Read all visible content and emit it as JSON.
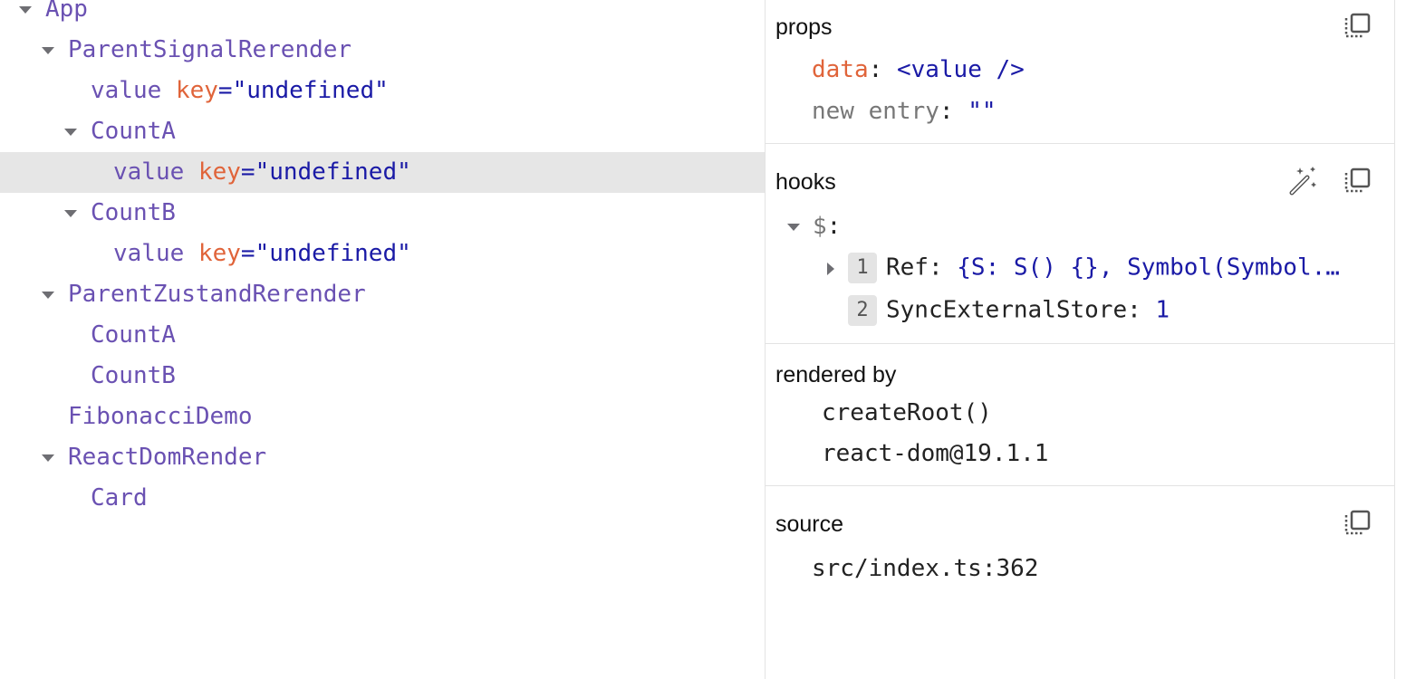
{
  "tree": [
    {
      "name": "App",
      "level": 0,
      "expanded": true
    },
    {
      "name": "ParentSignalRerender",
      "level": 1,
      "expanded": true
    },
    {
      "name": "value",
      "level": 2,
      "key_label": "key",
      "key_value": "\"undefined\""
    },
    {
      "name": "CountA",
      "level": 2,
      "expanded": true
    },
    {
      "name": "value",
      "level": 3,
      "key_label": "key",
      "key_value": "\"undefined\"",
      "selected": true
    },
    {
      "name": "CountB",
      "level": 2,
      "expanded": true
    },
    {
      "name": "value",
      "level": 3,
      "key_label": "key",
      "key_value": "\"undefined\""
    },
    {
      "name": "ParentZustandRerender",
      "level": 1,
      "expanded": true
    },
    {
      "name": "CountA",
      "level": 2
    },
    {
      "name": "CountB",
      "level": 2
    },
    {
      "name": "FibonacciDemo",
      "level": 1
    },
    {
      "name": "ReactDomRender",
      "level": 1,
      "expanded": true
    },
    {
      "name": "Card",
      "level": 2
    }
  ],
  "props": {
    "title": "props",
    "data_key": "data",
    "data_value": "<value />",
    "new_entry_key": "new entry",
    "new_entry_value": "\"\""
  },
  "hooks": {
    "title": "hooks",
    "group": "$",
    "items": [
      {
        "index": "1",
        "name": "Ref",
        "value": "{S: S() {}, Symbol(Symbol.…"
      },
      {
        "index": "2",
        "name": "SyncExternalStore",
        "value": "1"
      }
    ]
  },
  "rendered_by": {
    "title": "rendered by",
    "items": [
      "createRoot()",
      "react-dom@19.1.1"
    ]
  },
  "source": {
    "title": "source",
    "location": "src/index.ts:362"
  },
  "colors": {
    "component": "#6a51b2",
    "key": "#e0643a",
    "value": "#1a1aa6",
    "selected": "#e6e6e6"
  }
}
